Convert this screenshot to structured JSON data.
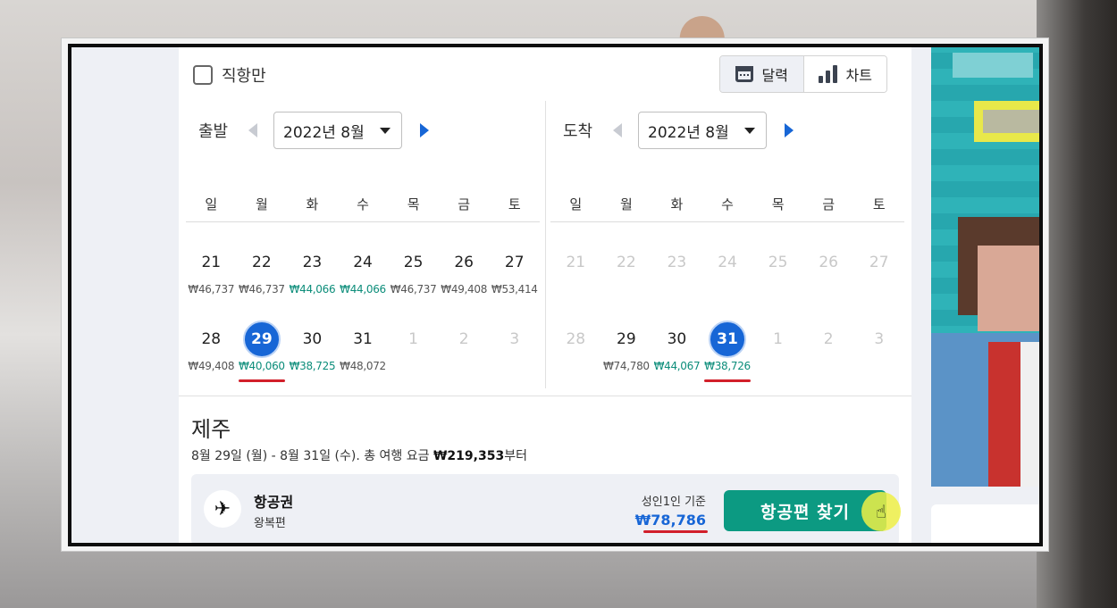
{
  "filter": {
    "direct_label": "직항만"
  },
  "view_toggle": {
    "calendar_label": "달력",
    "chart_label": "차트"
  },
  "departure": {
    "label": "출발",
    "month": "2022년 8월",
    "weekdays": [
      "일",
      "월",
      "화",
      "수",
      "목",
      "금",
      "토"
    ],
    "weeks": [
      [
        {
          "day": "21",
          "price": "₩46,737",
          "state": "normal",
          "cheap": false
        },
        {
          "day": "22",
          "price": "₩46,737",
          "state": "normal",
          "cheap": false
        },
        {
          "day": "23",
          "price": "₩44,066",
          "state": "normal",
          "cheap": true
        },
        {
          "day": "24",
          "price": "₩44,066",
          "state": "normal",
          "cheap": true
        },
        {
          "day": "25",
          "price": "₩46,737",
          "state": "normal",
          "cheap": false
        },
        {
          "day": "26",
          "price": "₩49,408",
          "state": "normal",
          "cheap": false
        },
        {
          "day": "27",
          "price": "₩53,414",
          "state": "normal",
          "cheap": false
        }
      ],
      [
        {
          "day": "28",
          "price": "₩49,408",
          "state": "normal",
          "cheap": false
        },
        {
          "day": "29",
          "price": "₩40,060",
          "state": "selected",
          "cheap": true
        },
        {
          "day": "30",
          "price": "₩38,725",
          "state": "normal",
          "cheap": true
        },
        {
          "day": "31",
          "price": "₩48,072",
          "state": "normal",
          "cheap": false
        },
        {
          "day": "1",
          "price": "",
          "state": "disabled",
          "cheap": false
        },
        {
          "day": "2",
          "price": "",
          "state": "disabled",
          "cheap": false
        },
        {
          "day": "3",
          "price": "",
          "state": "disabled",
          "cheap": false
        }
      ]
    ]
  },
  "arrival": {
    "label": "도착",
    "month": "2022년 8월",
    "weekdays": [
      "일",
      "월",
      "화",
      "수",
      "목",
      "금",
      "토"
    ],
    "weeks": [
      [
        {
          "day": "21",
          "price": "",
          "state": "disabled",
          "cheap": false
        },
        {
          "day": "22",
          "price": "",
          "state": "disabled",
          "cheap": false
        },
        {
          "day": "23",
          "price": "",
          "state": "disabled",
          "cheap": false
        },
        {
          "day": "24",
          "price": "",
          "state": "disabled",
          "cheap": false
        },
        {
          "day": "25",
          "price": "",
          "state": "disabled",
          "cheap": false
        },
        {
          "day": "26",
          "price": "",
          "state": "disabled",
          "cheap": false
        },
        {
          "day": "27",
          "price": "",
          "state": "disabled",
          "cheap": false
        }
      ],
      [
        {
          "day": "28",
          "price": "",
          "state": "disabled",
          "cheap": false
        },
        {
          "day": "29",
          "price": "₩74,780",
          "state": "normal",
          "cheap": false
        },
        {
          "day": "30",
          "price": "₩44,067",
          "state": "normal",
          "cheap": true
        },
        {
          "day": "31",
          "price": "₩38,726",
          "state": "selected",
          "cheap": true
        },
        {
          "day": "1",
          "price": "",
          "state": "disabled",
          "cheap": false
        },
        {
          "day": "2",
          "price": "",
          "state": "disabled",
          "cheap": false
        },
        {
          "day": "3",
          "price": "",
          "state": "disabled",
          "cheap": false
        }
      ]
    ]
  },
  "result": {
    "destination": "제주",
    "summary_prefix": "8월 29일 (월) - 8월 31일 (수). 총 여행 요금 ",
    "summary_total": "₩219,353",
    "summary_suffix": "부터",
    "card": {
      "title": "항공권",
      "subtitle": "왕복편",
      "base_label": "성인1인 기준",
      "base_price": "₩78,786",
      "find_button": "항공편 찾기"
    }
  },
  "colors": {
    "accent_blue": "#1766d6",
    "cheap_green": "#0c8d7a",
    "button_teal": "#0c9a82",
    "highlight_red": "#d21f2a"
  }
}
